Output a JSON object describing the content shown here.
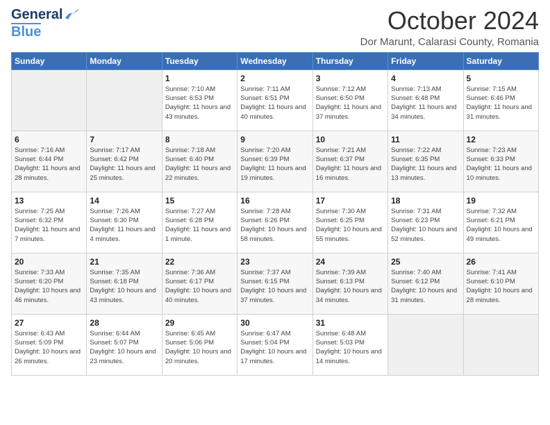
{
  "logo": {
    "line1": "General",
    "line2": "Blue"
  },
  "header": {
    "month_title": "October 2024",
    "subtitle": "Dor Marunt, Calarasi County, Romania"
  },
  "days_of_week": [
    "Sunday",
    "Monday",
    "Tuesday",
    "Wednesday",
    "Thursday",
    "Friday",
    "Saturday"
  ],
  "weeks": [
    [
      {
        "day": "",
        "sunrise": "",
        "sunset": "",
        "daylight": ""
      },
      {
        "day": "",
        "sunrise": "",
        "sunset": "",
        "daylight": ""
      },
      {
        "day": "1",
        "sunrise": "Sunrise: 7:10 AM",
        "sunset": "Sunset: 6:53 PM",
        "daylight": "Daylight: 11 hours and 43 minutes."
      },
      {
        "day": "2",
        "sunrise": "Sunrise: 7:11 AM",
        "sunset": "Sunset: 6:51 PM",
        "daylight": "Daylight: 11 hours and 40 minutes."
      },
      {
        "day": "3",
        "sunrise": "Sunrise: 7:12 AM",
        "sunset": "Sunset: 6:50 PM",
        "daylight": "Daylight: 11 hours and 37 minutes."
      },
      {
        "day": "4",
        "sunrise": "Sunrise: 7:13 AM",
        "sunset": "Sunset: 6:48 PM",
        "daylight": "Daylight: 11 hours and 34 minutes."
      },
      {
        "day": "5",
        "sunrise": "Sunrise: 7:15 AM",
        "sunset": "Sunset: 6:46 PM",
        "daylight": "Daylight: 11 hours and 31 minutes."
      }
    ],
    [
      {
        "day": "6",
        "sunrise": "Sunrise: 7:16 AM",
        "sunset": "Sunset: 6:44 PM",
        "daylight": "Daylight: 11 hours and 28 minutes."
      },
      {
        "day": "7",
        "sunrise": "Sunrise: 7:17 AM",
        "sunset": "Sunset: 6:42 PM",
        "daylight": "Daylight: 11 hours and 25 minutes."
      },
      {
        "day": "8",
        "sunrise": "Sunrise: 7:18 AM",
        "sunset": "Sunset: 6:40 PM",
        "daylight": "Daylight: 11 hours and 22 minutes."
      },
      {
        "day": "9",
        "sunrise": "Sunrise: 7:20 AM",
        "sunset": "Sunset: 6:39 PM",
        "daylight": "Daylight: 11 hours and 19 minutes."
      },
      {
        "day": "10",
        "sunrise": "Sunrise: 7:21 AM",
        "sunset": "Sunset: 6:37 PM",
        "daylight": "Daylight: 11 hours and 16 minutes."
      },
      {
        "day": "11",
        "sunrise": "Sunrise: 7:22 AM",
        "sunset": "Sunset: 6:35 PM",
        "daylight": "Daylight: 11 hours and 13 minutes."
      },
      {
        "day": "12",
        "sunrise": "Sunrise: 7:23 AM",
        "sunset": "Sunset: 6:33 PM",
        "daylight": "Daylight: 11 hours and 10 minutes."
      }
    ],
    [
      {
        "day": "13",
        "sunrise": "Sunrise: 7:25 AM",
        "sunset": "Sunset: 6:32 PM",
        "daylight": "Daylight: 11 hours and 7 minutes."
      },
      {
        "day": "14",
        "sunrise": "Sunrise: 7:26 AM",
        "sunset": "Sunset: 6:30 PM",
        "daylight": "Daylight: 11 hours and 4 minutes."
      },
      {
        "day": "15",
        "sunrise": "Sunrise: 7:27 AM",
        "sunset": "Sunset: 6:28 PM",
        "daylight": "Daylight: 11 hours and 1 minute."
      },
      {
        "day": "16",
        "sunrise": "Sunrise: 7:28 AM",
        "sunset": "Sunset: 6:26 PM",
        "daylight": "Daylight: 10 hours and 58 minutes."
      },
      {
        "day": "17",
        "sunrise": "Sunrise: 7:30 AM",
        "sunset": "Sunset: 6:25 PM",
        "daylight": "Daylight: 10 hours and 55 minutes."
      },
      {
        "day": "18",
        "sunrise": "Sunrise: 7:31 AM",
        "sunset": "Sunset: 6:23 PM",
        "daylight": "Daylight: 10 hours and 52 minutes."
      },
      {
        "day": "19",
        "sunrise": "Sunrise: 7:32 AM",
        "sunset": "Sunset: 6:21 PM",
        "daylight": "Daylight: 10 hours and 49 minutes."
      }
    ],
    [
      {
        "day": "20",
        "sunrise": "Sunrise: 7:33 AM",
        "sunset": "Sunset: 6:20 PM",
        "daylight": "Daylight: 10 hours and 46 minutes."
      },
      {
        "day": "21",
        "sunrise": "Sunrise: 7:35 AM",
        "sunset": "Sunset: 6:18 PM",
        "daylight": "Daylight: 10 hours and 43 minutes."
      },
      {
        "day": "22",
        "sunrise": "Sunrise: 7:36 AM",
        "sunset": "Sunset: 6:17 PM",
        "daylight": "Daylight: 10 hours and 40 minutes."
      },
      {
        "day": "23",
        "sunrise": "Sunrise: 7:37 AM",
        "sunset": "Sunset: 6:15 PM",
        "daylight": "Daylight: 10 hours and 37 minutes."
      },
      {
        "day": "24",
        "sunrise": "Sunrise: 7:39 AM",
        "sunset": "Sunset: 6:13 PM",
        "daylight": "Daylight: 10 hours and 34 minutes."
      },
      {
        "day": "25",
        "sunrise": "Sunrise: 7:40 AM",
        "sunset": "Sunset: 6:12 PM",
        "daylight": "Daylight: 10 hours and 31 minutes."
      },
      {
        "day": "26",
        "sunrise": "Sunrise: 7:41 AM",
        "sunset": "Sunset: 6:10 PM",
        "daylight": "Daylight: 10 hours and 28 minutes."
      }
    ],
    [
      {
        "day": "27",
        "sunrise": "Sunrise: 6:43 AM",
        "sunset": "Sunset: 5:09 PM",
        "daylight": "Daylight: 10 hours and 26 minutes."
      },
      {
        "day": "28",
        "sunrise": "Sunrise: 6:44 AM",
        "sunset": "Sunset: 5:07 PM",
        "daylight": "Daylight: 10 hours and 23 minutes."
      },
      {
        "day": "29",
        "sunrise": "Sunrise: 6:45 AM",
        "sunset": "Sunset: 5:06 PM",
        "daylight": "Daylight: 10 hours and 20 minutes."
      },
      {
        "day": "30",
        "sunrise": "Sunrise: 6:47 AM",
        "sunset": "Sunset: 5:04 PM",
        "daylight": "Daylight: 10 hours and 17 minutes."
      },
      {
        "day": "31",
        "sunrise": "Sunrise: 6:48 AM",
        "sunset": "Sunset: 5:03 PM",
        "daylight": "Daylight: 10 hours and 14 minutes."
      },
      {
        "day": "",
        "sunrise": "",
        "sunset": "",
        "daylight": ""
      },
      {
        "day": "",
        "sunrise": "",
        "sunset": "",
        "daylight": ""
      }
    ]
  ]
}
